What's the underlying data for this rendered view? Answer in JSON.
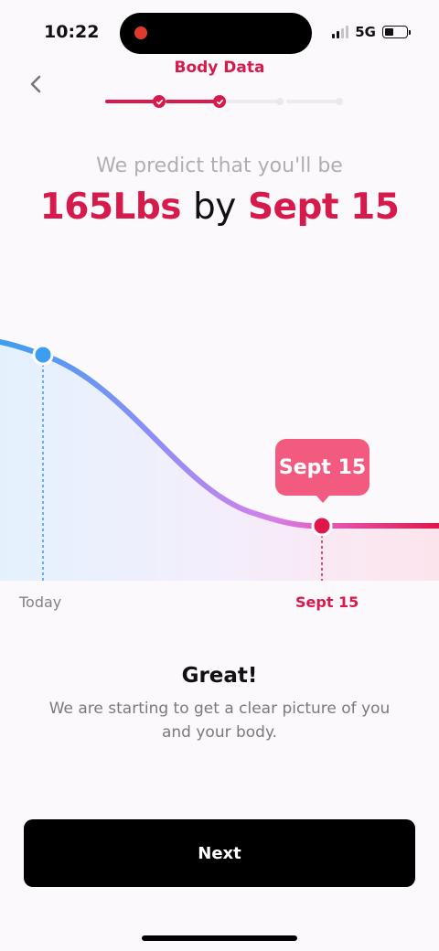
{
  "status_bar": {
    "time": "10:22",
    "network": "5G"
  },
  "header": {
    "title": "Body Data",
    "back_icon": "chevron-left-icon",
    "progress": {
      "total_steps": 5,
      "completed_steps": 2
    }
  },
  "prediction": {
    "subtitle": "We predict that you'll be",
    "weight": "165Lbs",
    "connector": "by",
    "date": "Sept 15"
  },
  "chart_data": {
    "type": "line",
    "title": "",
    "xlabel": "",
    "ylabel": "",
    "x": [
      "Today",
      "Sept 15"
    ],
    "markers": [
      {
        "label": "Today",
        "color": "#3d9ef0"
      },
      {
        "label": "Sept 15",
        "color": "#e0174a"
      }
    ],
    "tooltip": "Sept 15",
    "trend": "decreasing",
    "colors": {
      "start": "#3d9ef0",
      "mid": "#b57af0",
      "end": "#e0174a"
    }
  },
  "message": {
    "title": "Great!",
    "body": "We are starting to get a clear picture of you and your body."
  },
  "actions": {
    "next_label": "Next"
  },
  "colors": {
    "accent": "#d61a4c",
    "button": "#000000"
  }
}
